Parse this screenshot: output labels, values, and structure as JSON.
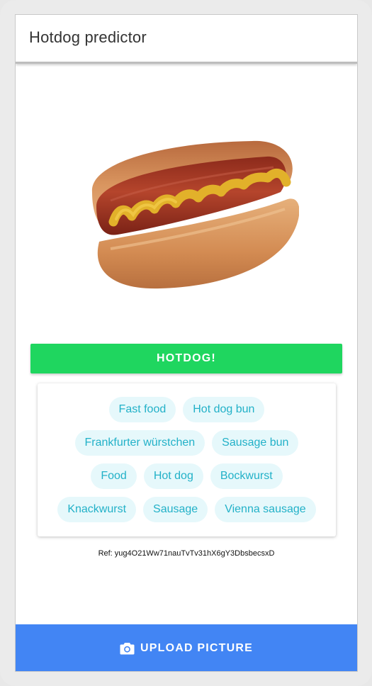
{
  "app": {
    "title": "Hotdog predictor"
  },
  "result": {
    "verdict": "HOTDOG!"
  },
  "tags": {
    "rows": [
      [
        "Fast food",
        "Hot dog bun"
      ],
      [
        "Frankfurter würstchen",
        "Sausage bun"
      ],
      [
        "Food",
        "Hot dog",
        "Bockwurst"
      ],
      [
        "Knackwurst",
        "Sausage",
        "Vienna sausage"
      ]
    ]
  },
  "reference": "Ref: yug4O21Ww71nauTvTv31hX6gY3DbsbecsxD",
  "upload": {
    "label": "UPLOAD PICTURE",
    "icon": "camera-icon"
  },
  "colors": {
    "verdict": "#1fd65f",
    "chip_bg": "#e6f8fb",
    "chip_text": "#22b1c8",
    "upload": "#4285f4"
  }
}
